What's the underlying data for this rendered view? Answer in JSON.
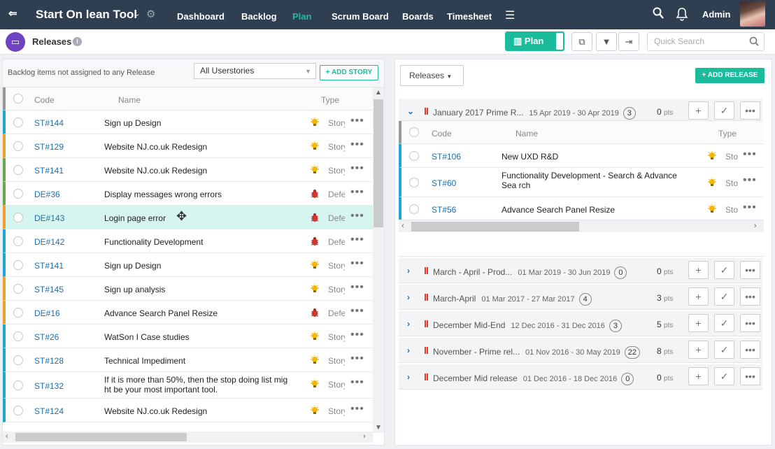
{
  "topbar": {
    "app_title": "Start On lean Tool",
    "nav": [
      "Dashboard",
      "Backlog",
      "Plan",
      "Scrum Board",
      "Boards",
      "Timesheet"
    ],
    "active_nav": "Plan",
    "user": "Admin"
  },
  "toolbar": {
    "page_title": "Releases",
    "plan_label": "Plan",
    "search_placeholder": "Quick Search"
  },
  "backlog": {
    "label": "Backlog items not assigned to any Release",
    "filter": "All Userstories",
    "add_story": "+ ADD STORY",
    "columns": {
      "code": "Code",
      "name": "Name",
      "type": "Type"
    },
    "rows": [
      {
        "code": "ST#144",
        "name": "Sign up Design",
        "type": "Story"
      },
      {
        "code": "ST#129",
        "name": "Website NJ.co.uk Redesign",
        "type": "Story"
      },
      {
        "code": "ST#141",
        "name": "Website NJ.co.uk Redesign",
        "type": "Story"
      },
      {
        "code": "DE#36",
        "name": "Display messages wrong errors",
        "type": "Defect"
      },
      {
        "code": "DE#143",
        "name": "Login page error",
        "type": "Defect"
      },
      {
        "code": "DE#142",
        "name": "Functionality Development",
        "type": "Defect"
      },
      {
        "code": "ST#141",
        "name": "Sign up Design",
        "type": "Story"
      },
      {
        "code": "ST#145",
        "name": "Sign up analysis",
        "type": "Story"
      },
      {
        "code": "DE#16",
        "name": "Advance Search Panel Resize",
        "type": "Defect"
      },
      {
        "code": "ST#26",
        "name": "WatSon I Case studies",
        "type": "Story"
      },
      {
        "code": "ST#128",
        "name": "Technical Impediment",
        "type": "Story"
      },
      {
        "code": "ST#132",
        "name": "If it is more than 50%, then the stop doing list mig ht be your most important tool.",
        "type": "Story"
      },
      {
        "code": "ST#124",
        "name": "Website NJ.co.uk Redesign",
        "type": "Story"
      }
    ]
  },
  "releases": {
    "button": "Releases",
    "add_release": "+ ADD RELEASE",
    "items": [
      {
        "name": "January 2017 Prime R...",
        "dates": "15 Apr 2019 - 30 Apr 2019",
        "count": "3",
        "pts": "0",
        "unit": "pts"
      },
      {
        "name": "March - April - Prod...",
        "dates": "01 Mar 2019 - 30 Jun 2019",
        "count": "0",
        "pts": "0",
        "unit": "pts"
      },
      {
        "name": "March-April",
        "dates": "01 Mar 2017 - 27 Mar 2017",
        "count": "4",
        "pts": "3",
        "unit": "pts"
      },
      {
        "name": "December Mid-End",
        "dates": "12 Dec 2016 - 31 Dec 2016",
        "count": "3",
        "pts": "5",
        "unit": "pts"
      },
      {
        "name": "November - Prime rel...",
        "dates": "01 Nov 2016 - 30 May 2019",
        "count": "22",
        "pts": "8",
        "unit": "pts"
      },
      {
        "name": "December Mid release",
        "dates": "01 Dec 2016 - 18 Dec 2016",
        "count": "0",
        "pts": "0",
        "unit": "pts"
      }
    ],
    "expanded_rows": [
      {
        "code": "ST#106",
        "name": "New UXD R&D",
        "type": "Story"
      },
      {
        "code": "ST#60",
        "name": "Functionality Development - Search & Advance Sea rch",
        "type": "Story"
      },
      {
        "code": "ST#56",
        "name": "Advance Search Panel Resize",
        "type": "Story"
      }
    ]
  },
  "colors": {
    "accent": "#1abc9c",
    "topbar": "#2f3f51",
    "link": "#1a6fb0",
    "highlight": "#d7f5ef"
  }
}
